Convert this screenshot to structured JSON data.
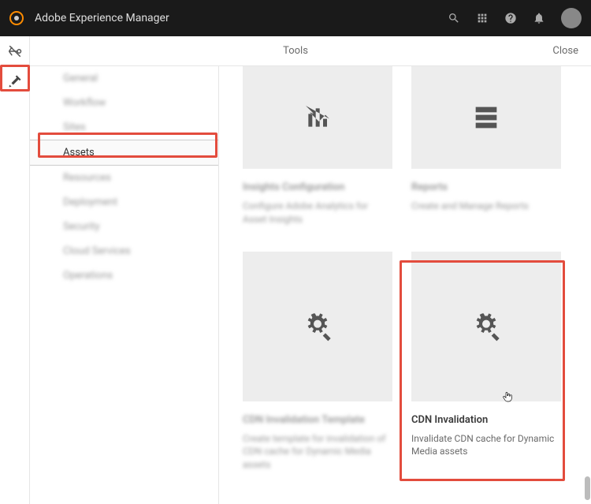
{
  "header": {
    "title": "Adobe Experience Manager"
  },
  "subheader": {
    "title": "Tools",
    "close": "Close"
  },
  "sidebar": {
    "items": [
      {
        "label": "General",
        "selected": false
      },
      {
        "label": "Workflow",
        "selected": false
      },
      {
        "label": "Sites",
        "selected": false
      },
      {
        "label": "Assets",
        "selected": true
      },
      {
        "label": "Resources",
        "selected": false
      },
      {
        "label": "Deployment",
        "selected": false
      },
      {
        "label": "Security",
        "selected": false
      },
      {
        "label": "Cloud Services",
        "selected": false
      },
      {
        "label": "Operations",
        "selected": false
      }
    ]
  },
  "cards": {
    "row1": [
      {
        "icon": "chart-up",
        "title": "Insights Configuration",
        "desc": "Configure Adobe Analytics for Asset Insights",
        "blurred": true
      },
      {
        "icon": "report",
        "title": "Reports",
        "desc": "Create and Manage Reports",
        "blurred": true
      }
    ],
    "row2": [
      {
        "icon": "gears-edit",
        "title": "CDN Invalidation Template",
        "desc": "Create template for invalidation of CDN cache for Dynamic Media assets",
        "blurred": true
      },
      {
        "icon": "gears-edit",
        "title": "CDN Invalidation",
        "desc": "Invalidate CDN cache for Dynamic Media assets",
        "blurred": false
      }
    ]
  }
}
